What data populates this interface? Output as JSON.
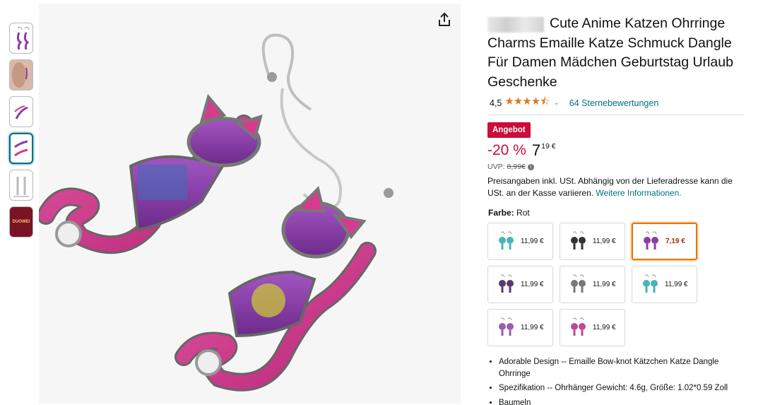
{
  "thumbnails": [
    {
      "name": "thumb-earrings-front",
      "kind": "earrings"
    },
    {
      "name": "thumb-model",
      "kind": "model"
    },
    {
      "name": "thumb-earrings-side",
      "kind": "earrings"
    },
    {
      "name": "thumb-earrings-diagonal",
      "kind": "earrings"
    },
    {
      "name": "thumb-earrings-dimensions",
      "kind": "earrings"
    },
    {
      "name": "thumb-brand-box",
      "kind": "brand",
      "label": "DUOWEI"
    }
  ],
  "product": {
    "title": "Cute Anime Katzen Ohrringe Charms Emaille Katze Schmuck Dangle Für Damen Mädchen Geburtstag Urlaub Geschenke",
    "rating": "4,5",
    "stars": "★★★★⯪",
    "reviews": "64 Sternebewertungen",
    "deal_badge": "Angebot",
    "discount": "-20 %",
    "price_whole": "7",
    "price_fraction": "19 €",
    "uvp_label": "UVP:",
    "uvp_value": "8,99€",
    "tax_text": "Preisangaben inkl. USt. Abhängig von der Lieferadresse kann die USt. an der Kasse variieren.",
    "tax_link": "Weitere Informationen.",
    "color_label": "Farbe:",
    "color_value": "Rot"
  },
  "swatches": [
    {
      "price": "11,99 €",
      "color": "#4ab3b8"
    },
    {
      "price": "11,99 €",
      "color": "#333333"
    },
    {
      "price": "7,19 €",
      "color": "#8b3fa0",
      "selected": true
    },
    {
      "price": "11,99 €",
      "color": "#5a3a6e"
    },
    {
      "price": "11,99 €",
      "color": "#777777"
    },
    {
      "price": "11,99 €",
      "color": "#4ab3b8"
    },
    {
      "price": "11,99 €",
      "color": "#9a5bb0"
    },
    {
      "price": "11,99 €",
      "color": "#c2469a"
    }
  ],
  "bullets": [
    "Adorable Design -- Emaille Bow-knot Kätzchen Katze Dangle Ohrringe",
    "Spezifikation -- Ohrhänger Gewicht: 4.6g, Größe: 1.02*0.59 Zoll",
    "Baumeln"
  ],
  "colors": {
    "accent": "#007185",
    "deal": "#cc0c39",
    "star": "#de7921",
    "selected_border": "#e77600",
    "cat_purple": "#8b3fa0",
    "cat_pink": "#d63b8f"
  }
}
